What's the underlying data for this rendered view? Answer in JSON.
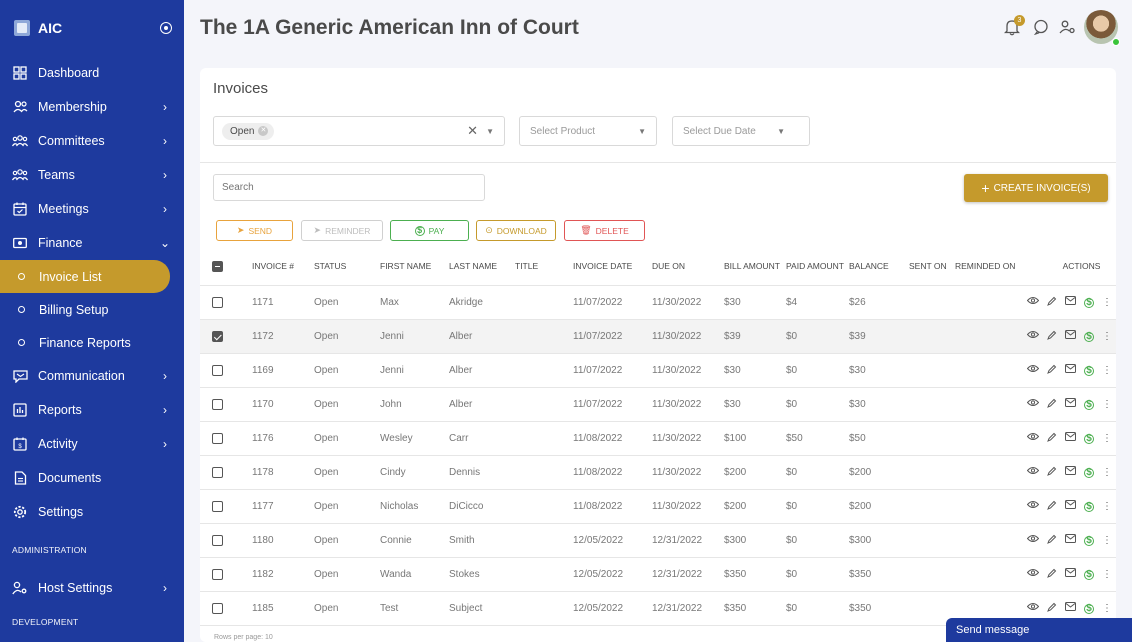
{
  "sidebar": {
    "app_name": "AIC",
    "items": [
      {
        "label": "Dashboard",
        "icon": "dashboard-icon",
        "chevron": ""
      },
      {
        "label": "Membership",
        "icon": "membership-icon",
        "chevron": "›"
      },
      {
        "label": "Committees",
        "icon": "committees-icon",
        "chevron": "›"
      },
      {
        "label": "Teams",
        "icon": "teams-icon",
        "chevron": "›"
      },
      {
        "label": "Meetings",
        "icon": "calendar-icon",
        "chevron": "›"
      },
      {
        "label": "Finance",
        "icon": "finance-icon",
        "chevron": "⌄"
      }
    ],
    "finance_sub": [
      {
        "label": "Invoice List"
      },
      {
        "label": "Billing Setup"
      },
      {
        "label": "Finance Reports"
      }
    ],
    "items2": [
      {
        "label": "Communication",
        "icon": "communication-icon",
        "chevron": "›"
      },
      {
        "label": "Reports",
        "icon": "reports-icon",
        "chevron": "›"
      },
      {
        "label": "Activity",
        "icon": "activity-icon",
        "chevron": "›"
      },
      {
        "label": "Documents",
        "icon": "documents-icon",
        "chevron": ""
      },
      {
        "label": "Settings",
        "icon": "settings-icon",
        "chevron": ""
      }
    ],
    "admin_section": "ADMINISTRATION",
    "host_settings": {
      "label": "Host Settings",
      "chevron": "›"
    },
    "dev_section": "DEVELOPMENT"
  },
  "header": {
    "title": "The 1A Generic American Inn of Court",
    "notification_count": "3"
  },
  "invoices": {
    "title": "Invoices",
    "status_filter": {
      "chip": "Open"
    },
    "product_placeholder": "Select Product",
    "due_date_placeholder": "Select Due Date",
    "search_placeholder": "Search",
    "create_label": "CREATE INVOICE(S)",
    "actions": {
      "send": "SEND",
      "reminder": "REMINDER",
      "pay": "PAY",
      "download": "DOWNLOAD",
      "delete": "DELETE"
    },
    "columns": {
      "invoice": "INVOICE #",
      "status": "STATUS",
      "first_name": "FIRST NAME",
      "last_name": "LAST NAME",
      "title": "TITLE",
      "invoice_date": "INVOICE DATE",
      "due_on": "DUE ON",
      "bill_amount": "BILL AMOUNT",
      "paid_amount": "PAID AMOUNT",
      "balance": "BALANCE",
      "sent_on": "SENT ON",
      "reminded_on": "REMINDED ON",
      "actions": "ACTIONS"
    },
    "rows": [
      {
        "invoice": "1171",
        "status": "Open",
        "first": "Max",
        "last": "Akridge",
        "title": "",
        "date": "11/07/2022",
        "due": "11/30/2022",
        "bill": "$30",
        "paid": "$4",
        "balance": "$26",
        "sent": "",
        "reminded": "",
        "checked": false
      },
      {
        "invoice": "1172",
        "status": "Open",
        "first": "Jenni",
        "last": "Alber",
        "title": "",
        "date": "11/07/2022",
        "due": "11/30/2022",
        "bill": "$39",
        "paid": "$0",
        "balance": "$39",
        "sent": "",
        "reminded": "",
        "checked": true
      },
      {
        "invoice": "1169",
        "status": "Open",
        "first": "Jenni",
        "last": "Alber",
        "title": "",
        "date": "11/07/2022",
        "due": "11/30/2022",
        "bill": "$30",
        "paid": "$0",
        "balance": "$30",
        "sent": "",
        "reminded": "",
        "checked": false
      },
      {
        "invoice": "1170",
        "status": "Open",
        "first": "John",
        "last": "Alber",
        "title": "",
        "date": "11/07/2022",
        "due": "11/30/2022",
        "bill": "$30",
        "paid": "$0",
        "balance": "$30",
        "sent": "",
        "reminded": "",
        "checked": false
      },
      {
        "invoice": "1176",
        "status": "Open",
        "first": "Wesley",
        "last": "Carr",
        "title": "",
        "date": "11/08/2022",
        "due": "11/30/2022",
        "bill": "$100",
        "paid": "$50",
        "balance": "$50",
        "sent": "",
        "reminded": "",
        "checked": false
      },
      {
        "invoice": "1178",
        "status": "Open",
        "first": "Cindy",
        "last": "Dennis",
        "title": "",
        "date": "11/08/2022",
        "due": "11/30/2022",
        "bill": "$200",
        "paid": "$0",
        "balance": "$200",
        "sent": "",
        "reminded": "",
        "checked": false
      },
      {
        "invoice": "1177",
        "status": "Open",
        "first": "Nicholas",
        "last": "DiCicco",
        "title": "",
        "date": "11/08/2022",
        "due": "11/30/2022",
        "bill": "$200",
        "paid": "$0",
        "balance": "$200",
        "sent": "",
        "reminded": "",
        "checked": false
      },
      {
        "invoice": "1180",
        "status": "Open",
        "first": "Connie",
        "last": "Smith",
        "title": "",
        "date": "12/05/2022",
        "due": "12/31/2022",
        "bill": "$300",
        "paid": "$0",
        "balance": "$300",
        "sent": "",
        "reminded": "",
        "checked": false
      },
      {
        "invoice": "1182",
        "status": "Open",
        "first": "Wanda",
        "last": "Stokes",
        "title": "",
        "date": "12/05/2022",
        "due": "12/31/2022",
        "bill": "$350",
        "paid": "$0",
        "balance": "$350",
        "sent": "",
        "reminded": "",
        "checked": false
      },
      {
        "invoice": "1185",
        "status": "Open",
        "first": "Test",
        "last": "Subject",
        "title": "",
        "date": "12/05/2022",
        "due": "12/31/2022",
        "bill": "$350",
        "paid": "$0",
        "balance": "$350",
        "sent": "",
        "reminded": "",
        "checked": false
      }
    ],
    "rows_per_page": "Rows per page: 10"
  },
  "send_message": "Send message",
  "colors": {
    "sidebar_bg": "#1e3a9e",
    "accent_gold": "#c59a2c",
    "send_orange": "#e8a33d",
    "pay_green": "#4caf50",
    "download_gold": "#c59a2c",
    "delete_red": "#e05555"
  }
}
